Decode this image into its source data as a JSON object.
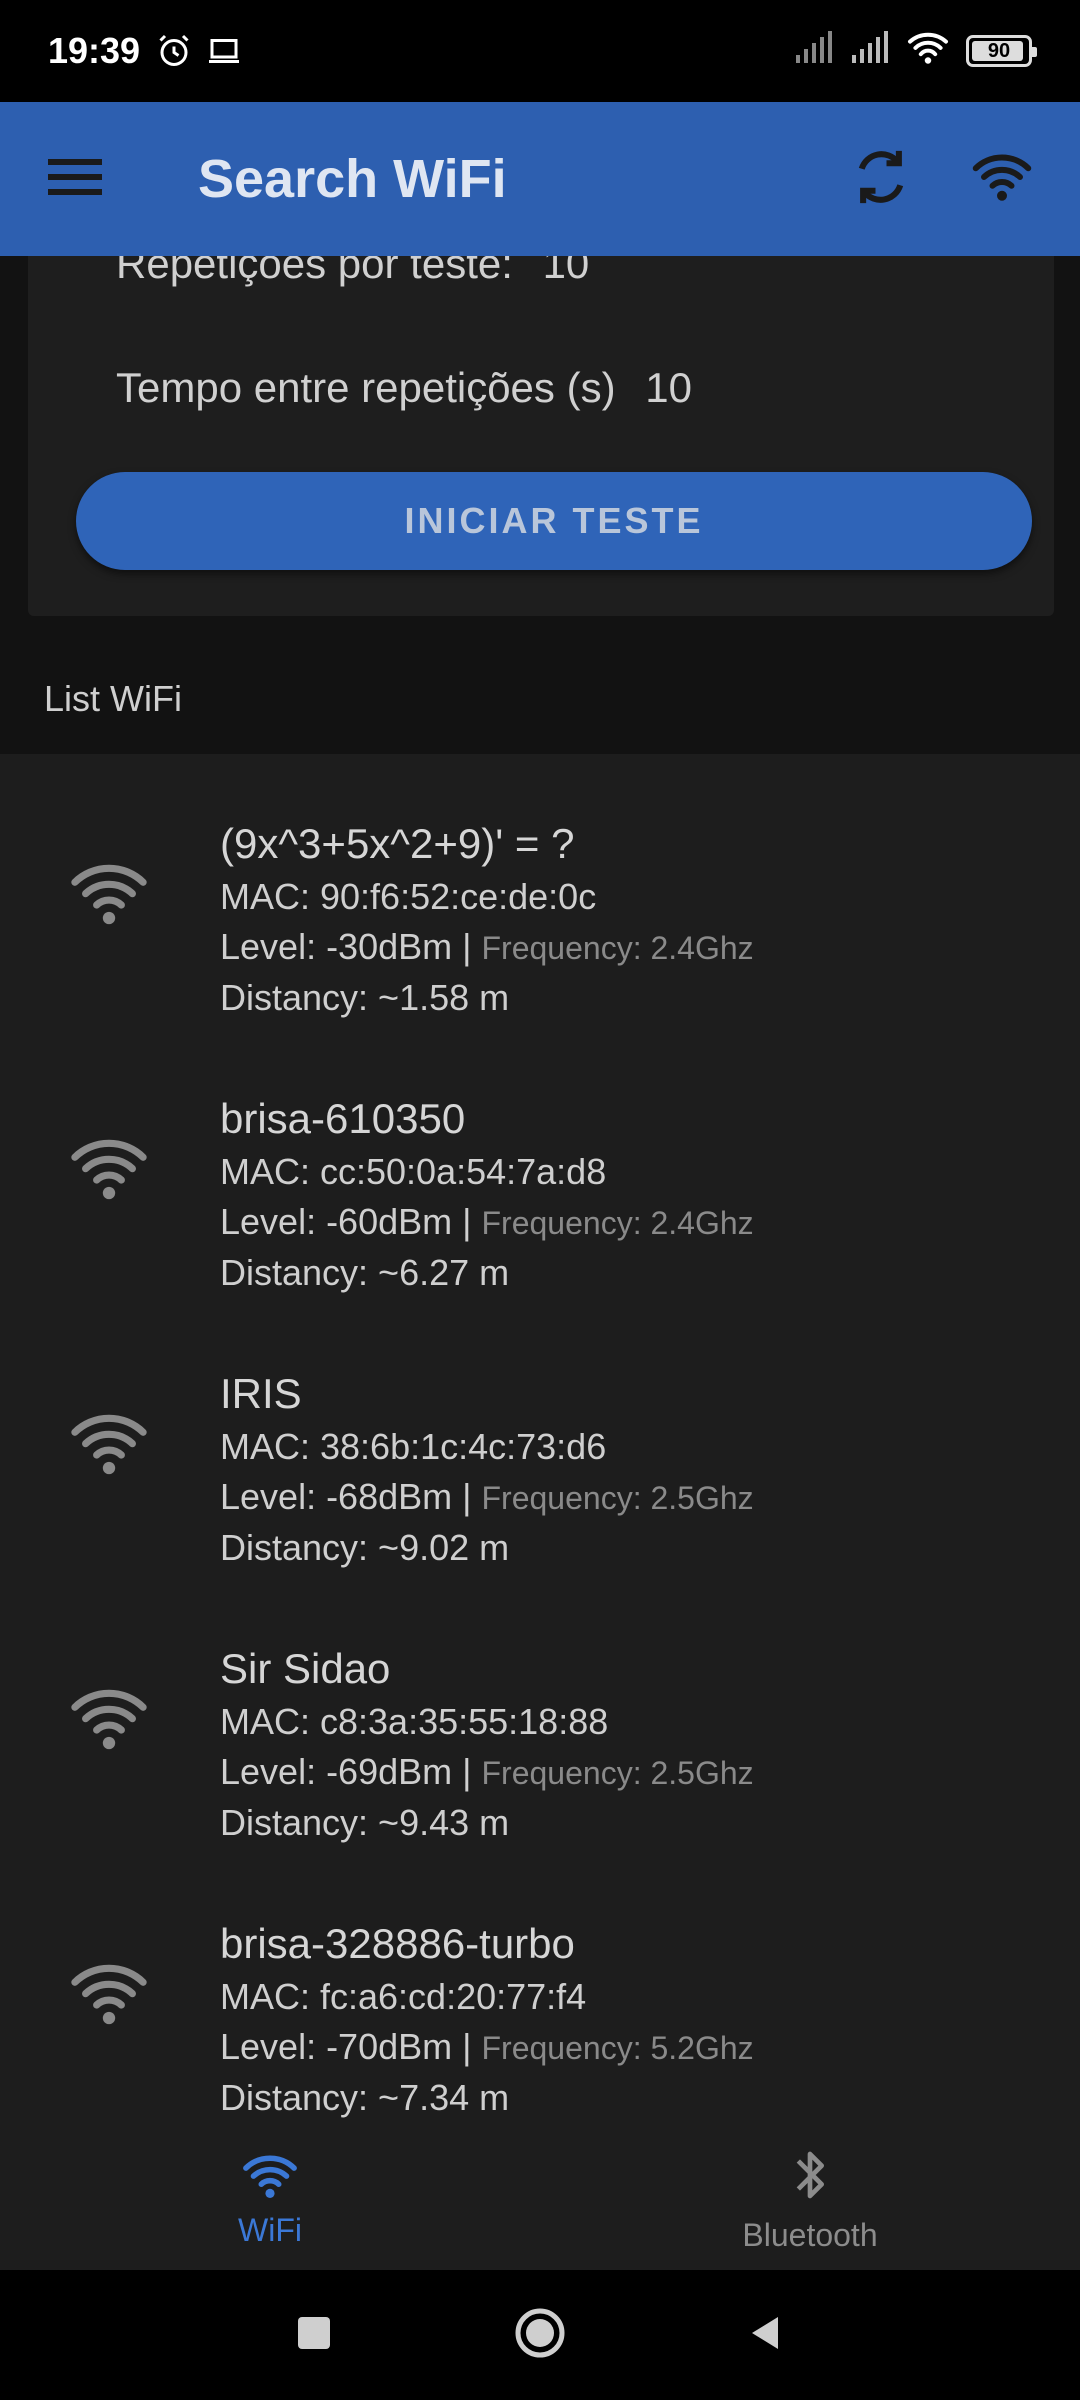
{
  "status_bar": {
    "time": "19:39",
    "battery": "90"
  },
  "app_bar": {
    "title": "Search WiFi"
  },
  "settings": {
    "partial_label": "Repetições por teste:",
    "partial_value": "10",
    "interval_label": "Tempo entre repetições (s)",
    "interval_value": "10",
    "start_button": "INICIAR TESTE"
  },
  "list_title": "List WiFi",
  "networks": [
    {
      "ssid": "(9x^3+5x^2+9)' = ?",
      "mac": "MAC: 90:f6:52:ce:de:0c",
      "level": "Level: -30dBm |",
      "frequency": "Frequency: 2.4Ghz",
      "distance": "Distancy: ~1.58 m"
    },
    {
      "ssid": "brisa-610350",
      "mac": "MAC: cc:50:0a:54:7a:d8",
      "level": "Level: -60dBm |",
      "frequency": "Frequency: 2.4Ghz",
      "distance": "Distancy: ~6.27 m"
    },
    {
      "ssid": "IRIS",
      "mac": "MAC: 38:6b:1c:4c:73:d6",
      "level": "Level: -68dBm |",
      "frequency": "Frequency: 2.5Ghz",
      "distance": "Distancy: ~9.02 m"
    },
    {
      "ssid": "Sir Sidao",
      "mac": "MAC: c8:3a:35:55:18:88",
      "level": "Level: -69dBm |",
      "frequency": "Frequency: 2.5Ghz",
      "distance": "Distancy: ~9.43 m"
    },
    {
      "ssid": "brisa-328886-turbo",
      "mac": "MAC: fc:a6:cd:20:77:f4",
      "level": "Level: -70dBm |",
      "frequency": "Frequency: 5.2Ghz",
      "distance": "Distancy: ~7.34 m"
    }
  ],
  "bottom_nav": {
    "wifi": "WiFi",
    "bluetooth": "Bluetooth"
  },
  "colors": {
    "app_bar": "#2d5fb0",
    "accent": "#3b78d6",
    "background": "#121212"
  }
}
